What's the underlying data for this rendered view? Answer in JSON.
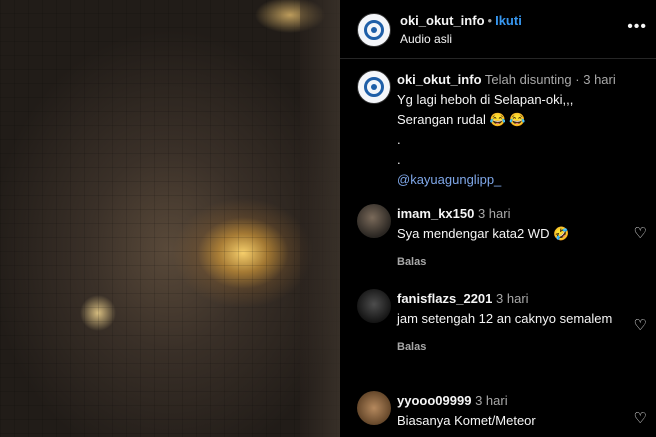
{
  "post": {
    "username": "oki_okut_info",
    "separator": "•",
    "follow_label": "Ikuti",
    "audio_label": "Audio asli",
    "more_icon": "more-options-icon"
  },
  "caption": {
    "username": "oki_okut_info",
    "edited_label": "Telah disunting",
    "dot": "·",
    "time": "3 hari",
    "lines": [
      "Yg lagi heboh di Selapan-oki,,,",
      "Serangan rudal 😂 😂",
      ".",
      "."
    ],
    "mention": "@kayuagunglipp_"
  },
  "comments": [
    {
      "username": "imam_kx150",
      "time": "3 hari",
      "text": "Sya mendengar kata2 WD 🤣",
      "reply_label": "Balas"
    },
    {
      "username": "fanisflazs_2201",
      "time": "3 hari",
      "text": "jam setengah 12 an caknyo semalem",
      "reply_label": "Balas"
    },
    {
      "username": "yyooo09999",
      "time": "3 hari",
      "text": "Biasanya Komet/Meteor"
    }
  ],
  "colors": {
    "background": "#000000",
    "link": "#3797f0",
    "muted": "#a8a8a8",
    "mention": "#7fa7e8"
  }
}
